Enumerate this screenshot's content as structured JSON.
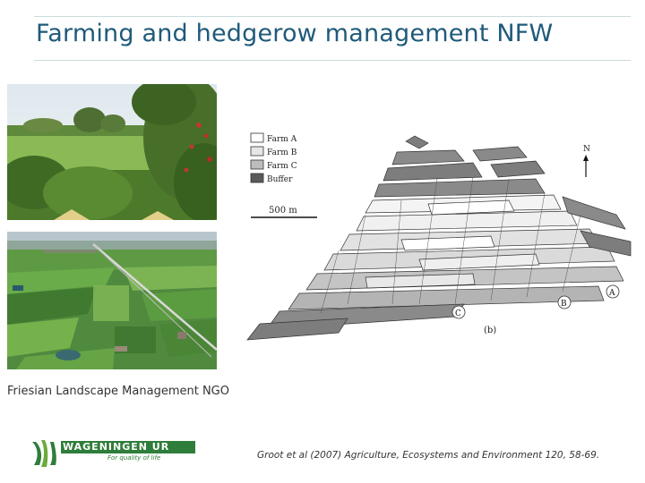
{
  "slide": {
    "title": "Farming and hedgerow management NFW",
    "photo_caption": "Friesian Landscape Management NGO",
    "citation": "Groot et al (2007) Agriculture, Ecosystems and Environment 120, 58-69."
  },
  "logo": {
    "wordmark": "WAGENINGEN UR",
    "tagline": "For quality of life"
  },
  "map_figure": {
    "legend": [
      {
        "label": "Farm A",
        "fill": "#ffffff"
      },
      {
        "label": "Farm B",
        "fill": "#e6e6e6"
      },
      {
        "label": "Farm C",
        "fill": "#bdbdbd"
      },
      {
        "label": "Buffer",
        "fill": "#5a5a5a"
      }
    ],
    "scale_label": "500 m",
    "north_label": "N",
    "farm_markers": [
      "A",
      "B",
      "C"
    ],
    "panel_label": "(b)"
  },
  "colors": {
    "title": "#1f5a7a",
    "rule": "#c9dcdc",
    "brand_green": "#2f7d3a"
  }
}
